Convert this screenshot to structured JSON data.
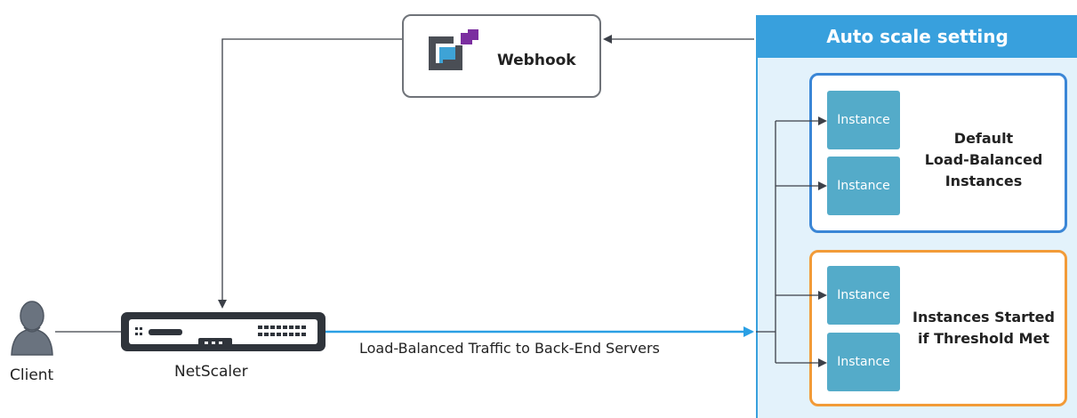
{
  "webhook": {
    "label": "Webhook",
    "icon": "webhook-logo-icon"
  },
  "client": {
    "label": "Client",
    "icon": "user-icon"
  },
  "netscaler": {
    "label": "NetScaler",
    "icon": "appliance-icon"
  },
  "traffic_label": "Load-Balanced Traffic to Back-End Servers",
  "auto_scale": {
    "title": "Auto scale setting",
    "default_group": {
      "label_lines": [
        "Default",
        "Load-Balanced",
        "Instances"
      ],
      "instances": [
        "Instance",
        "Instance"
      ]
    },
    "threshold_group": {
      "label_lines": [
        "Instances Started",
        "if Threshold Met"
      ],
      "instances": [
        "Instance",
        "Instance"
      ]
    }
  },
  "colors": {
    "panel_blue": "#38a0dd",
    "panel_bg": "#e3f2fb",
    "instance": "#54abc9",
    "default_border": "#3a86d6",
    "threshold_border": "#f29b38",
    "traffic_line": "#2a9fe4",
    "connector": "#3c4048",
    "webhook_purple": "#7b2ea0"
  }
}
